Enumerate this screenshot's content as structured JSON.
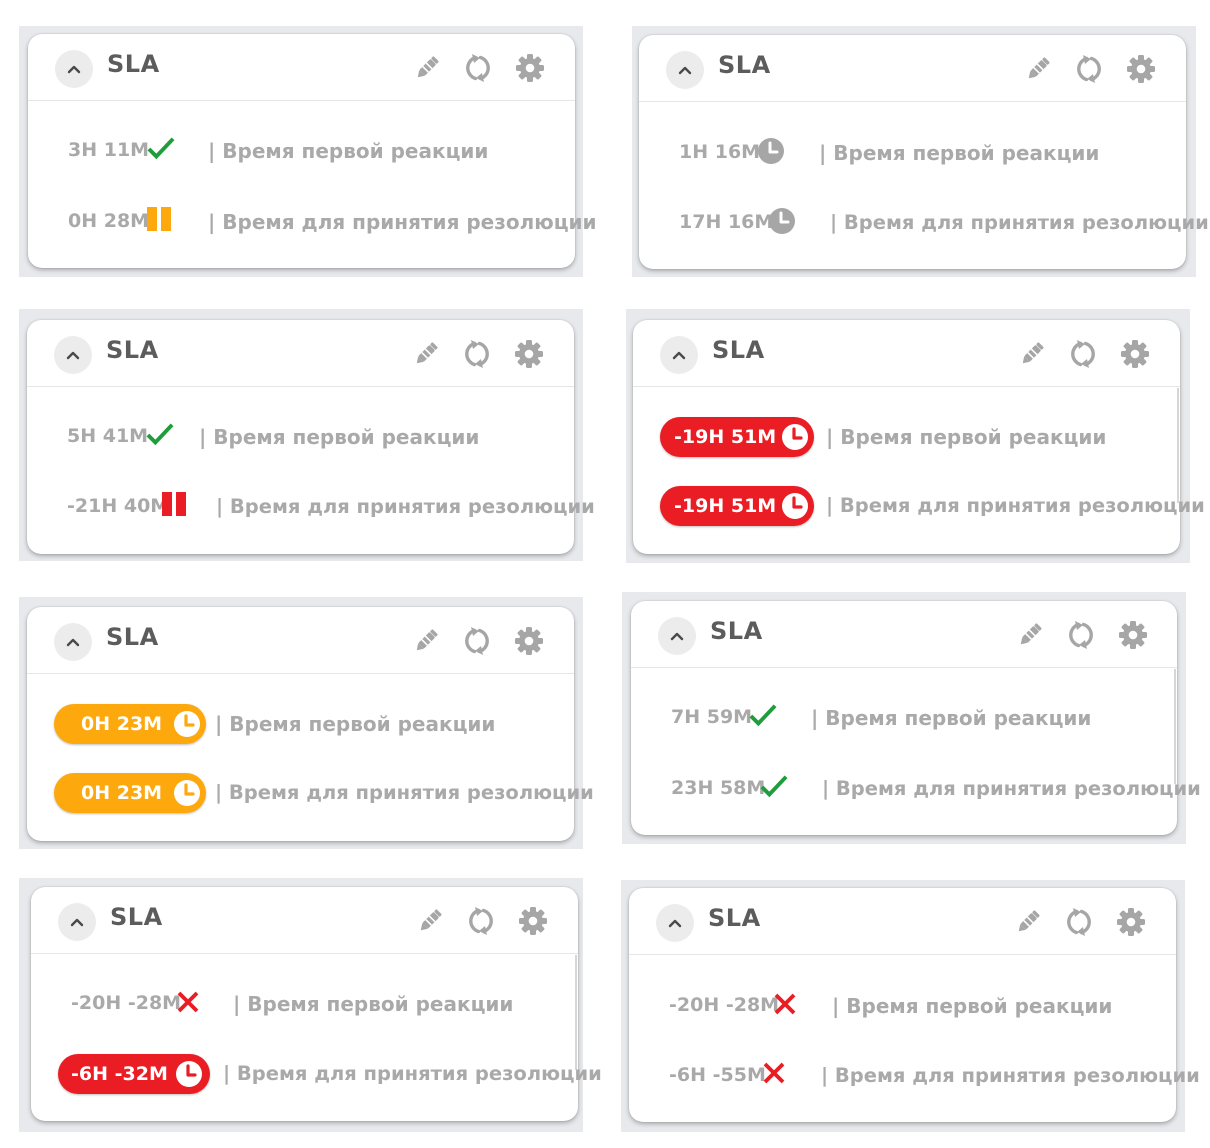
{
  "colors": {
    "green": "#1f9d3c",
    "orange": "#fda80d",
    "red": "#ea1c24",
    "grey": "#a9a9a9",
    "title": "#5c5c5c"
  },
  "cards": [
    {
      "title": "SLA",
      "rows": [
        {
          "value": "3H 11M",
          "status_icon": "check-icon",
          "label": "| Время первой реакции"
        },
        {
          "value": "0H 28M",
          "status_icon": "pause-icon-orange",
          "label": "| Время для принятия резолюции"
        }
      ]
    },
    {
      "title": "SLA",
      "rows": [
        {
          "value": "1H 16M",
          "status_icon": "clock-icon-grey",
          "label": "| Время первой реакции"
        },
        {
          "value": "17H 16M",
          "status_icon": "clock-icon-grey",
          "label": "| Время для принятия резолюции"
        }
      ]
    },
    {
      "title": "SLA",
      "rows": [
        {
          "value": "5H 41M",
          "status_icon": "check-icon",
          "label": "| Время первой реакции"
        },
        {
          "value": "-21H 40M",
          "status_icon": "pause-icon-red",
          "label": "| Время для принятия резолюции"
        }
      ]
    },
    {
      "title": "SLA",
      "rows": [
        {
          "value": "-19H 51M",
          "status_icon": "clock-icon-white",
          "label": "| Время первой реакции"
        },
        {
          "value": "-19H 51M",
          "status_icon": "clock-icon-white",
          "label": "| Время для принятия резолюции"
        }
      ]
    },
    {
      "title": "SLA",
      "rows": [
        {
          "value": "0H 23M",
          "status_icon": "clock-icon-white",
          "label": "| Время первой реакции"
        },
        {
          "value": "0H 23M",
          "status_icon": "clock-icon-white",
          "label": "| Время для принятия резолюции"
        }
      ]
    },
    {
      "title": "SLA",
      "rows": [
        {
          "value": "7H 59M",
          "status_icon": "check-icon",
          "label": "| Время первой реакции"
        },
        {
          "value": "23H 58M",
          "status_icon": "check-icon",
          "label": "| Время для принятия резолюции"
        }
      ]
    },
    {
      "title": "SLA",
      "rows": [
        {
          "value": "-20H -28M",
          "status_icon": "cross-icon",
          "label": "| Время первой реакции"
        },
        {
          "value": "-6H -32M",
          "status_icon": "clock-icon-white",
          "label": "| Время для принятия резолюции"
        }
      ]
    },
    {
      "title": "SLA",
      "rows": [
        {
          "value": "-20H -28M",
          "status_icon": "cross-icon",
          "label": "| Время первой реакции"
        },
        {
          "value": "-6H -55M",
          "status_icon": "cross-icon",
          "label": "| Время для принятия резолюции"
        }
      ]
    }
  ]
}
